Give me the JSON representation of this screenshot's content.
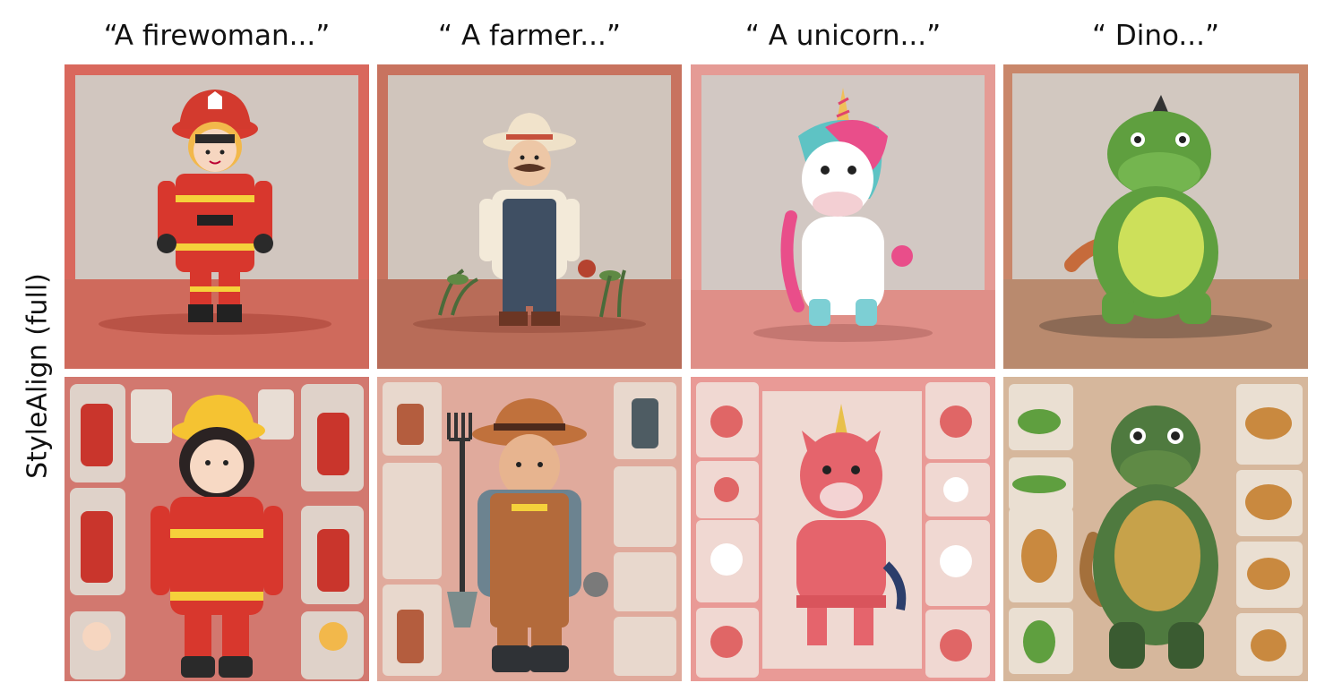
{
  "columns": [
    {
      "caption": "“A firewoman...”",
      "subject": "firewoman"
    },
    {
      "caption": "“ A farmer...”",
      "subject": "farmer"
    },
    {
      "caption": "“ A unicorn...”",
      "subject": "unicorn"
    },
    {
      "caption": "“ Dino...”",
      "subject": "dinosaur"
    }
  ],
  "row_label": "StyleAlign (full)",
  "rows": [
    {
      "variant": "single-character"
    },
    {
      "variant": "character-sheet"
    }
  ],
  "colors": {
    "frame_red": "#d9685d",
    "frame_brown": "#c9876a",
    "wall": "#cfc3bb",
    "unicorn_frame": "#e59b95",
    "dino_frame": "#d4b296"
  }
}
